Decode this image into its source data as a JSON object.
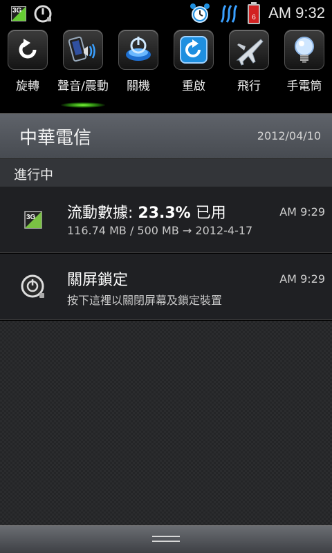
{
  "status_bar": {
    "time": "AM 9:32",
    "left_icons": [
      "3g-icon",
      "power-lock-icon"
    ],
    "right_icons": [
      "alarm-clock-icon",
      "signal-waves-icon",
      "battery-icon"
    ],
    "mini_3g_label": "3G"
  },
  "toggles": [
    {
      "label": "旋轉",
      "icon": "rotate-icon"
    },
    {
      "label": "聲音/震動",
      "icon": "sound-vibrate-icon",
      "active": true
    },
    {
      "label": "關機",
      "icon": "power-icon"
    },
    {
      "label": "重啟",
      "icon": "restart-icon"
    },
    {
      "label": "飛行",
      "icon": "airplane-icon"
    },
    {
      "label": "手電筒",
      "icon": "flashlight-icon"
    }
  ],
  "carrier": {
    "name": "中華電信",
    "date": "2012/04/10"
  },
  "ongoing_header": "進行中",
  "notifications": [
    {
      "icon": "3g-data-icon",
      "icon_label": "3G",
      "title_prefix": "流動數據: ",
      "title_value": "23.3%",
      "title_suffix": " 已用",
      "subtitle": "116.74 MB / 500 MB → 2012-4-17",
      "time": "AM 9:29"
    },
    {
      "icon": "screen-lock-power-icon",
      "title": "關屏鎖定",
      "subtitle": "按下這裡以關閉屏幕及鎖定裝置",
      "time": "AM 9:29"
    }
  ],
  "colors": {
    "accent_glow": "#7dff3a",
    "battery_red": "#d22222",
    "icon_blue": "#1e8fe0"
  }
}
